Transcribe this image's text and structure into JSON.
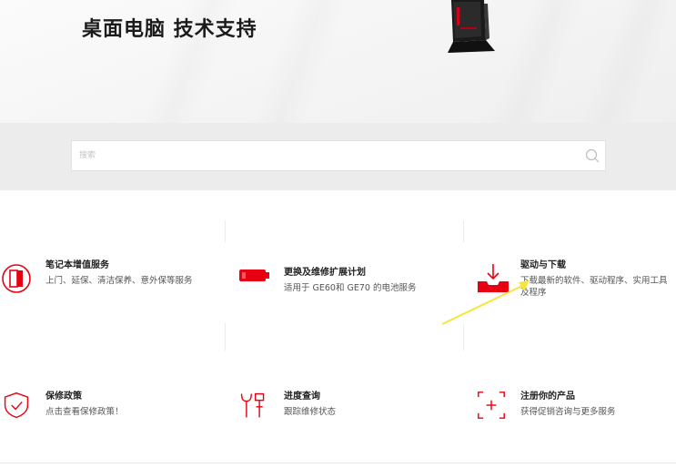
{
  "hero": {
    "title": "桌面电脑 技术支持"
  },
  "search": {
    "placeholder": "搜索"
  },
  "services": [
    {
      "title": "笔记本增值服务",
      "desc": "上门、延保、清洁保养、意外保等服务",
      "icon": "notebook-door-icon"
    },
    {
      "title": "更换及维修扩展计划",
      "desc": "适用于 GE60和 GE70 的电池服务",
      "icon": "battery-icon"
    },
    {
      "title": "驱动与下载",
      "desc": "下载最新的软件、驱动程序、实用工具及程序",
      "icon": "download-tray-icon"
    },
    {
      "title": "保修政策",
      "desc": "点击查看保修政策！",
      "icon": "shield-check-icon"
    },
    {
      "title": "进度查询",
      "desc": "跟踪维修状态",
      "icon": "tools-icon"
    },
    {
      "title": "注册你的产品",
      "desc": "获得促销咨询与更多服务",
      "icon": "register-plus-icon"
    }
  ],
  "colors": {
    "accent": "#e60012",
    "annotation": "#f5e63a"
  }
}
